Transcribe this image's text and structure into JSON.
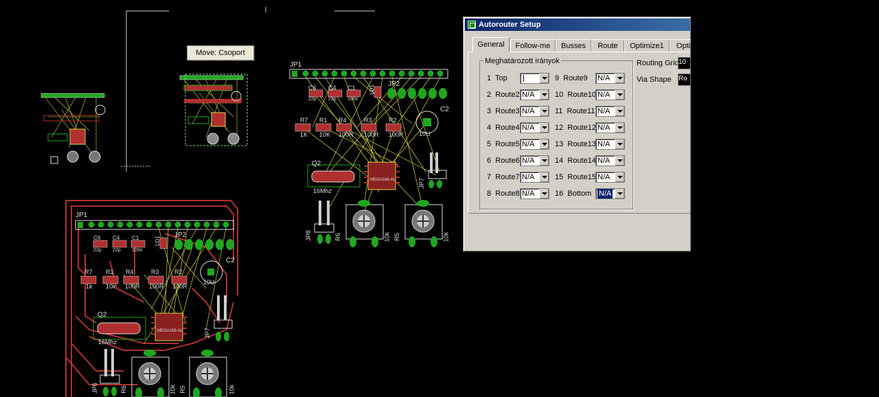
{
  "tooltip": {
    "text": "Move: Csoport"
  },
  "board": {
    "header_right": "JP1",
    "header_bottom": "JP1",
    "right": {
      "caps": [
        "C6",
        "C4",
        "C1"
      ],
      "cap_values": [
        "22p",
        "22p",
        "100n"
      ],
      "resistors": [
        "R7",
        "R1",
        "R4",
        "R3",
        "R2"
      ],
      "resistor_values": [
        "1K",
        "10K",
        "100R",
        "100R",
        "100R"
      ],
      "ld": "LD1",
      "jp2": "JP2",
      "c2": "C2",
      "c2_val": "10U",
      "q": "Q2",
      "q_val": "16Mhz",
      "ic": "MEGA168-AU",
      "jp7": "JP7",
      "jp8": "JP8",
      "r6": "R6",
      "r6v": "10k",
      "r5": "R5",
      "r5v": "10k"
    },
    "bottom": {
      "caps": [
        "C6",
        "C4",
        "C1"
      ],
      "cap_values": [
        "22p",
        "22p",
        "100n"
      ],
      "resistors": [
        "R7",
        "R1",
        "R4",
        "R3",
        "R2"
      ],
      "resistor_values": [
        "1k",
        "10k",
        "100R",
        "100R",
        "100R"
      ],
      "ld": "LD1",
      "jp2": "JP2",
      "c2": "C2",
      "c2_val": "10U",
      "q": "Q2",
      "q_val": "16Mhz",
      "ic": "MEGA168-AU",
      "jp7": "JP7",
      "jp6": "JP6",
      "r6": "R6",
      "r6v": "10k",
      "r5": "R5",
      "r5v": "10k"
    }
  },
  "dialog": {
    "title": "Autorouter Setup",
    "tabs": [
      "General",
      "Follow-me",
      "Busses",
      "Route",
      "Optimize1",
      "Opti"
    ],
    "active_tab": "General",
    "group_title": "Meghatározott irányok",
    "layers_left": [
      {
        "num": "1",
        "name": "Top",
        "value": ""
      },
      {
        "num": "2",
        "name": "Route2",
        "value": "N/A"
      },
      {
        "num": "3",
        "name": "Route3",
        "value": "N/A"
      },
      {
        "num": "4",
        "name": "Route4",
        "value": "N/A"
      },
      {
        "num": "5",
        "name": "Route5",
        "value": "N/A"
      },
      {
        "num": "6",
        "name": "Route6",
        "value": "N/A"
      },
      {
        "num": "7",
        "name": "Route7",
        "value": "N/A"
      },
      {
        "num": "8",
        "name": "Route8",
        "value": "N/A"
      }
    ],
    "layers_right": [
      {
        "num": "9",
        "name": "Route9",
        "value": "N/A"
      },
      {
        "num": "10",
        "name": "Route10",
        "value": "N/A"
      },
      {
        "num": "11",
        "name": "Route11",
        "value": "N/A"
      },
      {
        "num": "12",
        "name": "Route12",
        "value": "N/A"
      },
      {
        "num": "13",
        "name": "Route13",
        "value": "N/A"
      },
      {
        "num": "14",
        "name": "Route14",
        "value": "N/A"
      },
      {
        "num": "15",
        "name": "Route15",
        "value": "N/A"
      },
      {
        "num": "16",
        "name": "Bottom",
        "value": "N/A"
      }
    ],
    "routing_grid_label": "Routing Grid",
    "via_shape_label": "Via Shape",
    "routing_grid_value": "10",
    "via_shape_value": "Ro"
  },
  "colors": {
    "copper": "#b03030",
    "airwire": "#d8d840",
    "pad": "#1fa81f",
    "silk": "#d8d8d8",
    "dialog_bg": "#d4d0c8",
    "title_bar": "#0a246a"
  }
}
